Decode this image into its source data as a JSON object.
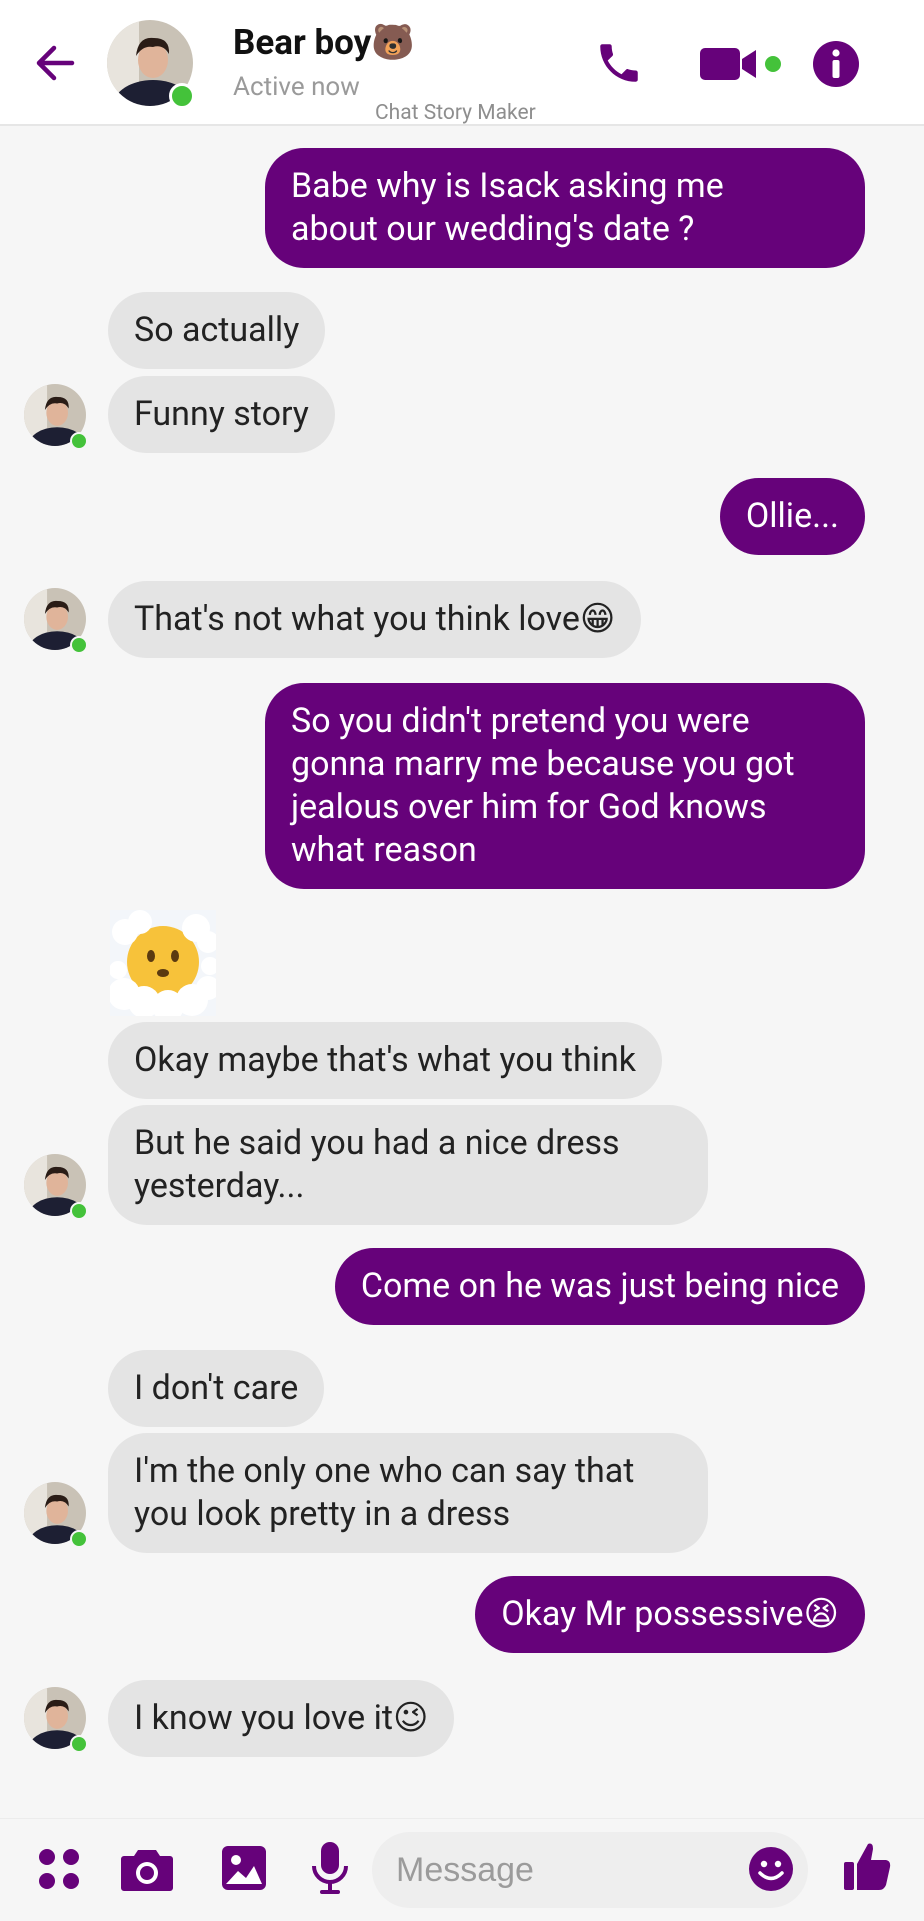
{
  "header": {
    "contact_name": "Bear boy🐻",
    "status": "Active now",
    "watermark": "Chat Story Maker",
    "icons": [
      "back-arrow-icon",
      "phone-icon",
      "video-camera-icon",
      "info-icon"
    ]
  },
  "colors": {
    "accent": "#66027a",
    "outgoing_bubble": "#66027a",
    "incoming_bubble": "#e4e4e4",
    "online": "#44c23a"
  },
  "messages": [
    {
      "side": "out",
      "text": "Babe why is Isack asking me\nabout our wedding's date ?"
    },
    {
      "side": "in",
      "text": "So actually"
    },
    {
      "side": "in",
      "text": "Funny story"
    },
    {
      "side": "out",
      "text": "Ollie..."
    },
    {
      "side": "in",
      "text": "That's not what you think love😁"
    },
    {
      "side": "out",
      "text": "So you didn't pretend you were\ngonna marry me because you got\njealous over him for God knows\nwhat reason"
    },
    {
      "side": "in",
      "type": "sticker",
      "icon": "face-in-clouds-emoji"
    },
    {
      "side": "in",
      "text": "Okay maybe that's what you think"
    },
    {
      "side": "in",
      "text": "But he said you had a nice dress\nyesterday..."
    },
    {
      "side": "out",
      "text": "Come on he was just being nice"
    },
    {
      "side": "in",
      "text": "I don't care"
    },
    {
      "side": "in",
      "text": "I'm the only one who can say that\nyou look pretty in a dress"
    },
    {
      "side": "out",
      "text": "Okay Mr possessive😫"
    },
    {
      "side": "in",
      "text": "I know you love it😉"
    }
  ],
  "composer": {
    "placeholder": "Message",
    "icons": [
      "apps-icon",
      "camera-icon",
      "gallery-icon",
      "microphone-icon",
      "emoji-icon",
      "thumbs-up-icon"
    ]
  }
}
